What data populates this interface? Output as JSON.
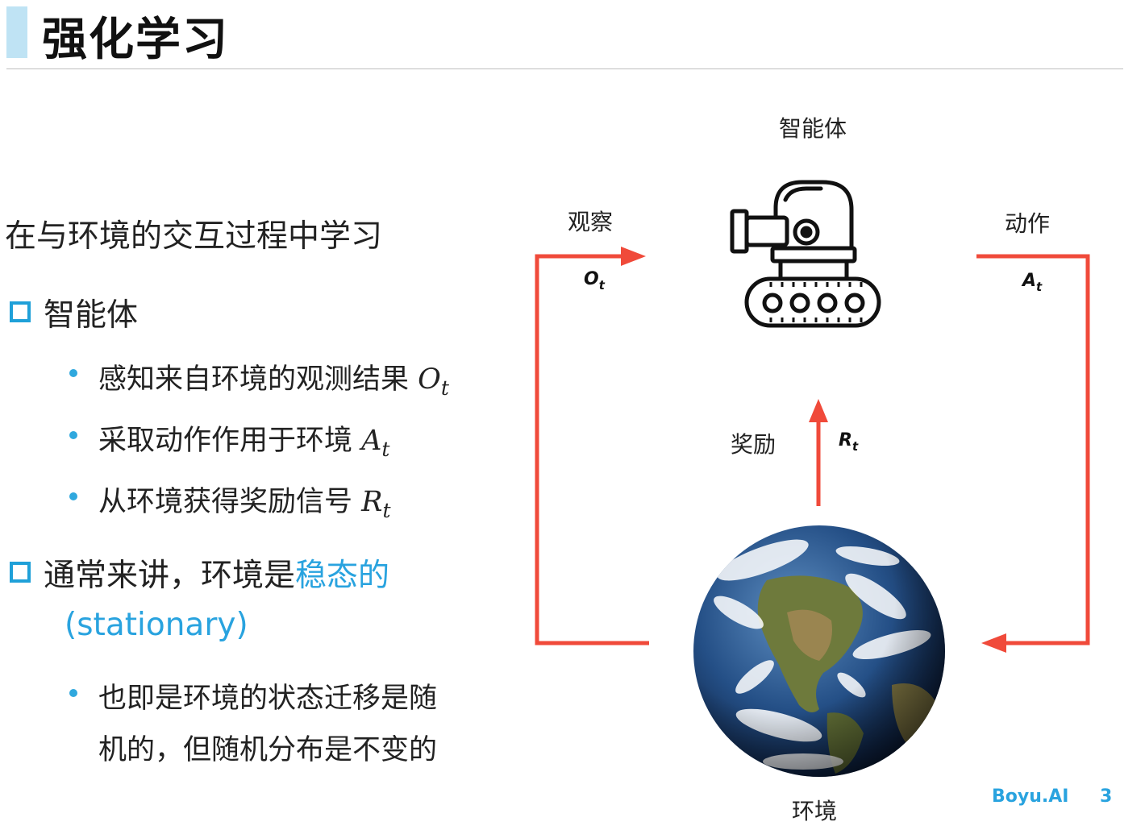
{
  "header": {
    "title": "强化学习"
  },
  "body": {
    "lead": "在与环境的交互过程中学习",
    "bullets": [
      {
        "label": "智能体",
        "items": [
          {
            "text": "感知来自环境的观测结果 ",
            "var": "O",
            "sub": "t"
          },
          {
            "text": "采取动作作用于环境 ",
            "var": "A",
            "sub": "t"
          },
          {
            "text": "从环境获得奖励信号 ",
            "var": "R",
            "sub": "t"
          }
        ]
      },
      {
        "label_plain": "通常来讲，环境是",
        "label_highlight": "稳态的",
        "label_line2": "(stationary)",
        "items": [
          {
            "line1": "也即是环境的状态迁移是随",
            "line2": "机的，但随机分布是不变的"
          }
        ]
      }
    ]
  },
  "diagram": {
    "agent_label": "智能体",
    "environment_label": "环境",
    "observe_label": "观察",
    "observe_symbol": {
      "var": "O",
      "sub": "t"
    },
    "action_label": "动作",
    "action_symbol": {
      "var": "A",
      "sub": "t"
    },
    "reward_label": "奖励",
    "reward_symbol": {
      "var": "R",
      "sub": "t"
    },
    "arrow_color": "#f04a3a",
    "agent_icon": "robot-tank-icon",
    "environment_icon": "earth-globe-icon"
  },
  "footer": {
    "brand": "Boyu.AI",
    "page_number": "3"
  },
  "colors": {
    "accent": "#29a3df",
    "title_bar": "#bfe3f4",
    "arrow": "#f04a3a"
  }
}
